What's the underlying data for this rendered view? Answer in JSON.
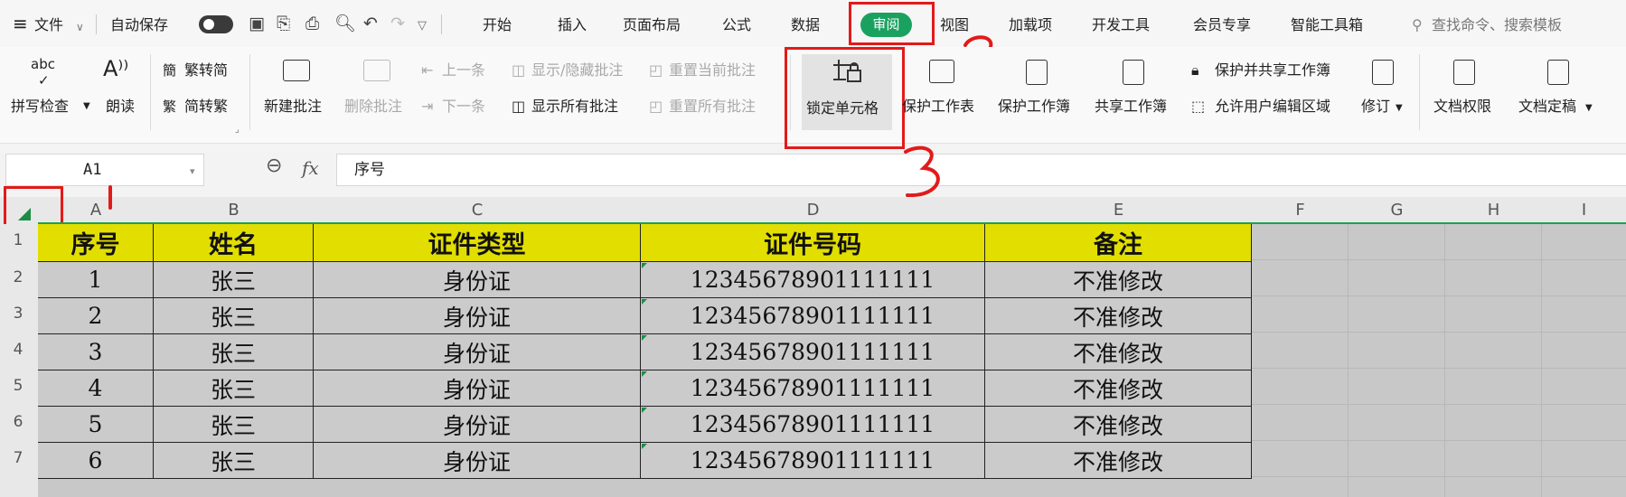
{
  "menubar": {
    "file_label": "文件",
    "autosave_label": "自动保存",
    "tabs": [
      "开始",
      "插入",
      "页面布局",
      "公式",
      "数据",
      "审阅",
      "视图",
      "加载项",
      "开发工具",
      "会员专享",
      "智能工具箱"
    ],
    "active_tab_label": "审阅",
    "search_placeholder": "查找命令、搜索模板"
  },
  "ribbon": {
    "spell_check": "拼写检查",
    "read_aloud": "朗读",
    "trad_simplified": "繁转简",
    "simp_traditional": "简转繁",
    "new_comment": "新建批注",
    "delete_comment": "删除批注",
    "prev_item": "上一条",
    "next_item": "下一条",
    "show_hide_comments": "显示/隐藏批注",
    "show_all_comments": "显示所有批注",
    "reset_current_comment": "重置当前批注",
    "reset_all_comments": "重置所有批注",
    "lock_cell": "锁定单元格",
    "protect_sheet": "保护工作表",
    "protect_workbook": "保护工作簿",
    "share_workbook": "共享工作簿",
    "protect_share_workbook": "保护并共享工作簿",
    "allow_edit_ranges": "允许用户编辑区域",
    "revisions": "修订",
    "doc_permissions": "文档权限",
    "doc_finalize": "文档定稿"
  },
  "formula_bar": {
    "name_box": "A1",
    "fx_label": "fx",
    "content": "序号"
  },
  "grid": {
    "columns": [
      "A",
      "B",
      "C",
      "D",
      "E",
      "F",
      "G",
      "H",
      "I"
    ],
    "row_numbers": [
      "1",
      "2",
      "3",
      "4",
      "5",
      "6",
      "7"
    ],
    "header_row": [
      "序号",
      "姓名",
      "证件类型",
      "证件号码",
      "备注"
    ],
    "rows": [
      [
        "1",
        "张三",
        "身份证",
        "12345678901111111",
        "不准修改"
      ],
      [
        "2",
        "张三",
        "身份证",
        "12345678901111111",
        "不准修改"
      ],
      [
        "3",
        "张三",
        "身份证",
        "12345678901111111",
        "不准修改"
      ],
      [
        "4",
        "张三",
        "身份证",
        "12345678901111111",
        "不准修改"
      ],
      [
        "5",
        "张三",
        "身份证",
        "12345678901111111",
        "不准修改"
      ],
      [
        "6",
        "张三",
        "身份证",
        "12345678901111111",
        "不准修改"
      ]
    ]
  },
  "annotations": {
    "step1": "1",
    "step2": "2",
    "step3": "3",
    "color": "#e21a1a"
  },
  "colors": {
    "accent_green": "#1aa160",
    "header_fill": "#e2de00",
    "cell_fill": "#cbcbcb"
  }
}
